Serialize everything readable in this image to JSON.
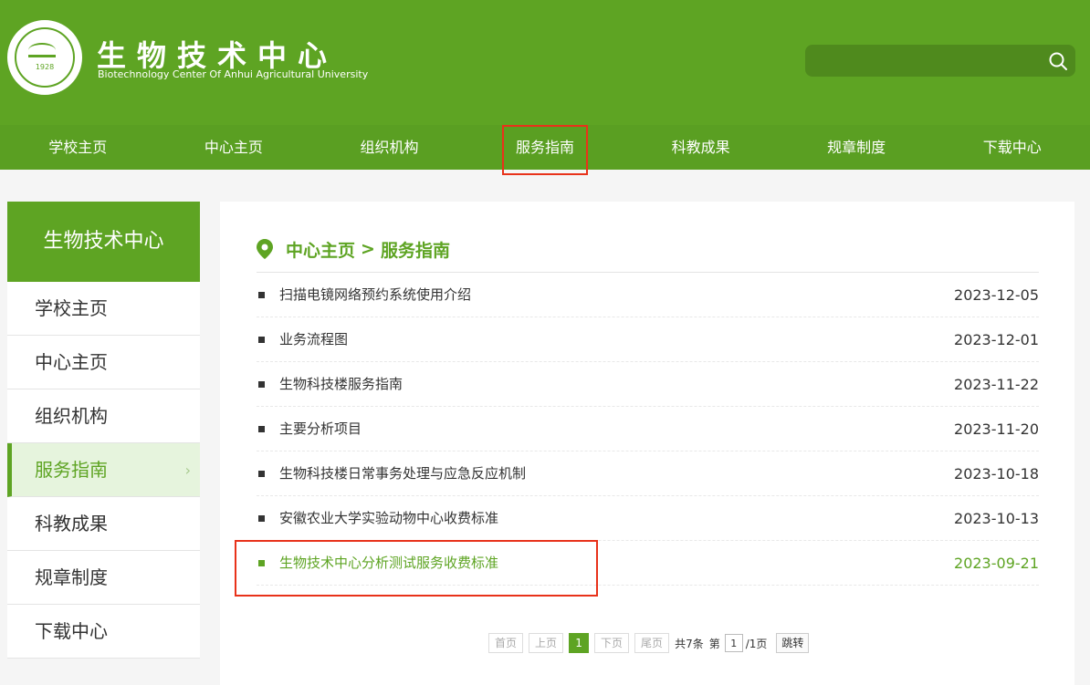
{
  "header": {
    "title": "生物技术中心",
    "subtitle": "Biotechnology Center Of Anhui Agricultural University",
    "logo_year": "1928",
    "search_placeholder": ""
  },
  "nav": {
    "items": [
      {
        "label": "学校主页"
      },
      {
        "label": "中心主页"
      },
      {
        "label": "组织机构"
      },
      {
        "label": "服务指南"
      },
      {
        "label": "科教成果"
      },
      {
        "label": "规章制度"
      },
      {
        "label": "下载中心"
      }
    ]
  },
  "sidebar": {
    "title": "生物技术中心",
    "items": [
      {
        "label": "学校主页"
      },
      {
        "label": "中心主页"
      },
      {
        "label": "组织机构"
      },
      {
        "label": "服务指南"
      },
      {
        "label": "科教成果"
      },
      {
        "label": "规章制度"
      },
      {
        "label": "下载中心"
      }
    ],
    "active_chevron": "›"
  },
  "breadcrumb": {
    "home": "中心主页",
    "sep": ">",
    "current": "服务指南"
  },
  "articles": [
    {
      "title": "扫描电镜网络预约系统使用介绍",
      "date": "2023-12-05"
    },
    {
      "title": "业务流程图",
      "date": "2023-12-01"
    },
    {
      "title": "生物科技楼服务指南",
      "date": "2023-11-22"
    },
    {
      "title": "主要分析项目",
      "date": "2023-11-20"
    },
    {
      "title": "生物科技楼日常事务处理与应急反应机制",
      "date": "2023-10-18"
    },
    {
      "title": "安徽农业大学实验动物中心收费标准",
      "date": "2023-10-13"
    },
    {
      "title": "生物技术中心分析测试服务收费标准",
      "date": "2023-09-21"
    }
  ],
  "pagination": {
    "first": "首页",
    "prev": "上页",
    "current": "1",
    "next": "下页",
    "last": "尾页",
    "total_text": "共7条",
    "page_prefix": "第",
    "page_value": "1",
    "page_suffix": "/1页",
    "jump": "跳转"
  },
  "colors": {
    "brand_green": "#5ea423",
    "highlight_red": "#e8321a"
  },
  "icons": {
    "search": "search-icon",
    "breadcrumb": "map-pin-icon"
  }
}
